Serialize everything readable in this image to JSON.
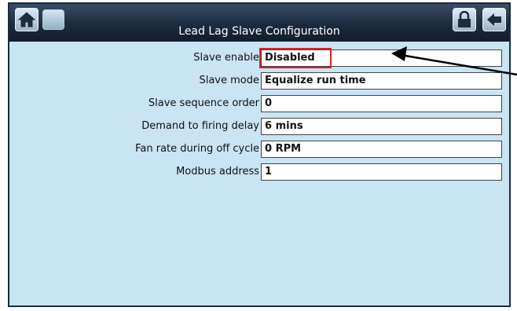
{
  "header": {
    "title": "Lead Lag Slave Configuration",
    "home_icon": "home-icon",
    "blank_icon": "blank-tile-icon",
    "lock_icon": "lock-icon",
    "back_icon": "back-arrow-icon"
  },
  "settings": [
    {
      "label": "Slave enable",
      "value": "Disabled"
    },
    {
      "label": "Slave mode",
      "value": "Equalize run time"
    },
    {
      "label": "Slave sequence order",
      "value": "0"
    },
    {
      "label": "Demand to firing delay",
      "value": "6 mins"
    },
    {
      "label": "Fan rate during off cycle",
      "value": "0 RPM"
    },
    {
      "label": "Modbus address",
      "value": "1"
    }
  ],
  "colors": {
    "screen_background": "#c9e4f2",
    "titlebar": "#1d2b3f",
    "highlight_box": "#e01f26"
  }
}
